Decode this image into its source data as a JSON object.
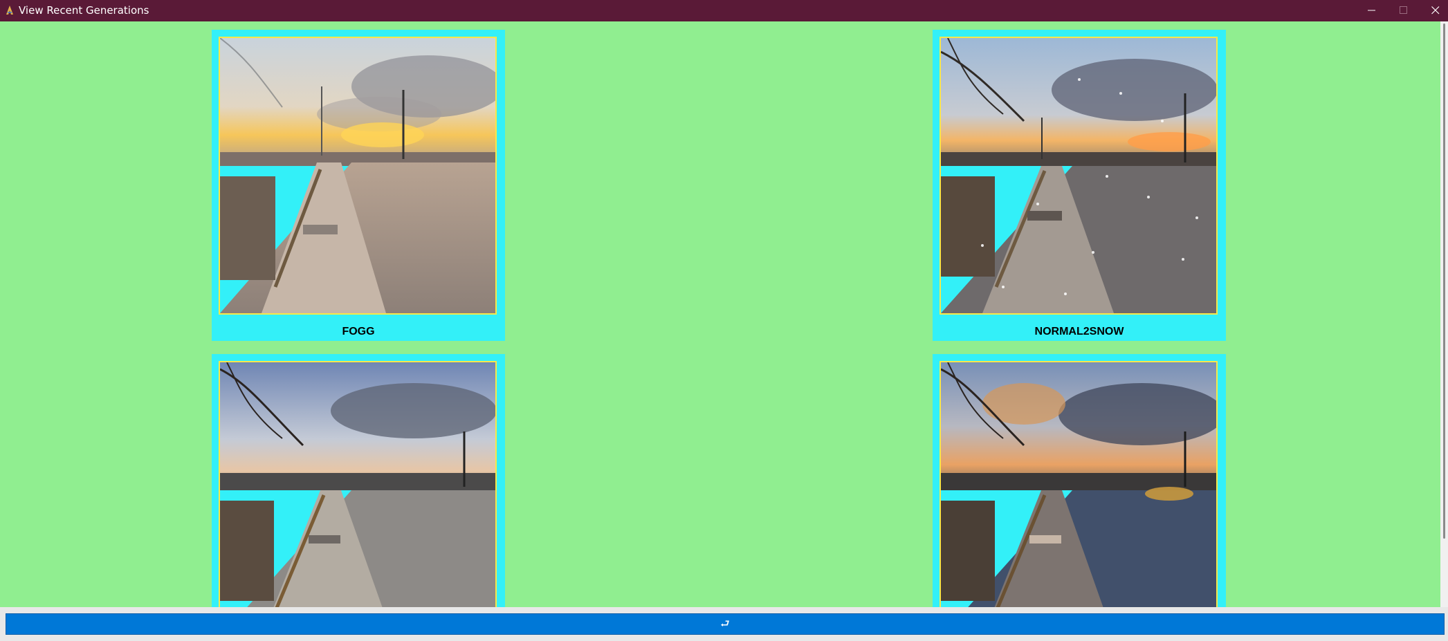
{
  "window": {
    "title": "View Recent Generations",
    "icons": [
      "python-feather-icon",
      "minimize-icon",
      "maximize-icon",
      "close-icon"
    ]
  },
  "gallery": {
    "items": [
      {
        "label": "FOGG",
        "image": "foggy-street-sunset-image"
      },
      {
        "label": "NORMAL2SNOW",
        "image": "snowy-street-sunset-image"
      },
      {
        "label": "",
        "image": "rainy-street-overcast-image"
      },
      {
        "label": "",
        "image": "wet-street-dusk-image"
      }
    ]
  },
  "footer": {
    "button_label": "⮐"
  },
  "colors": {
    "titlebar": "#5a1a37",
    "background": "#90ee90",
    "card": "#33f0f8",
    "thumb_border": "#f7e84a",
    "button": "#0078d7"
  }
}
